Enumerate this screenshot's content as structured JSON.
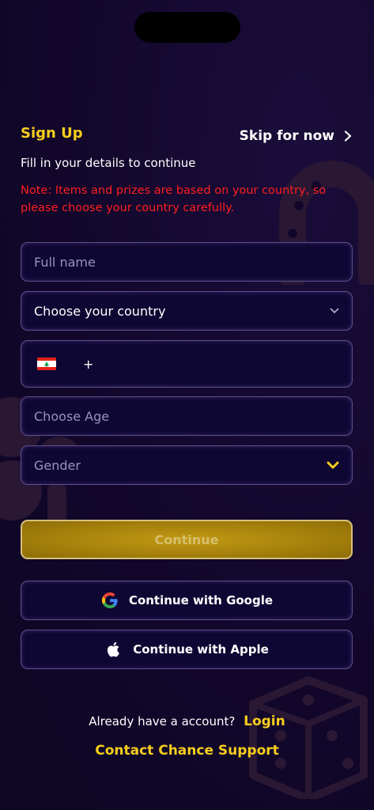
{
  "header": {
    "title": "Sign Up",
    "skip_label": "Skip for now",
    "subtitle": "Fill in your details to continue",
    "note": "Note: Items and prizes are based on your country, so please choose your country carefully."
  },
  "form": {
    "full_name_placeholder": "Full name",
    "country_value": "Choose your country",
    "phone_prefix": "+",
    "age_placeholder": "Choose Age",
    "gender_placeholder": "Gender"
  },
  "actions": {
    "continue_label": "Continue",
    "google_label": "Continue with Google",
    "apple_label": "Continue with Apple"
  },
  "footer": {
    "already_text": "Already have a account?",
    "login_label": "Login",
    "support_label": "Contact Chance Support"
  },
  "colors": {
    "accent": "#f7cd1c",
    "note_red": "#ff1e1e",
    "background": "#12072b",
    "field_bg": "#0f0733",
    "button_gold": "#a47f0b"
  },
  "icons": {
    "skip": "chevron-right-icon",
    "country_dropdown": "chevron-down-icon",
    "gender_dropdown": "chevron-down-icon",
    "phone_flag": "lebanon-flag-icon",
    "google": "google-icon",
    "apple": "apple-icon"
  }
}
